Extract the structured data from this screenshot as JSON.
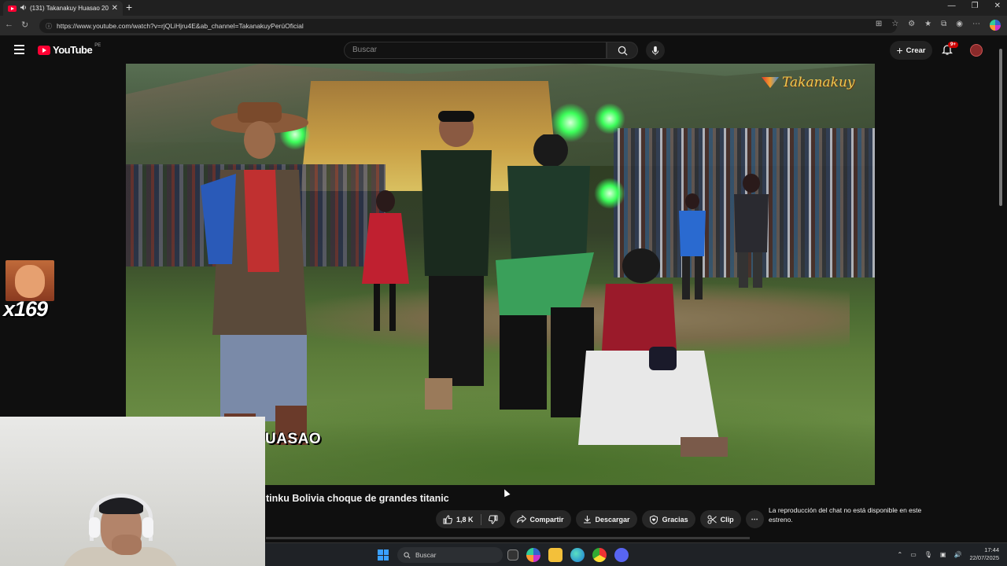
{
  "browser": {
    "tab_title": "(131) Takanakuy Huasao 20…",
    "url": "https://www.youtube.com/watch?v=rjQLiHjru4E&ab_channel=TakanakuyPerúOficial"
  },
  "youtube": {
    "logo_text": "YouTube",
    "country_code": "PE",
    "search_placeholder": "Buscar",
    "create_label": "Crear",
    "notifications_badge": "9+"
  },
  "video": {
    "watermark_text": "Takanakuy",
    "caption_overlay": "UASAO",
    "title": "tinku Bolivia choque de grandes titanic"
  },
  "overlay": {
    "multiplier_text": "x169"
  },
  "actions": {
    "like_count": "1,8 K",
    "share_label": "Compartir",
    "download_label": "Descargar",
    "thanks_label": "Gracias",
    "clip_label": "Clip"
  },
  "chat": {
    "unavailable_text": "La reproducción del chat no está disponible en este estreno."
  },
  "taskbar": {
    "search_placeholder": "Buscar",
    "time": "17:44",
    "date": "22/07/2025"
  },
  "colors": {
    "youtube_red": "#ff0033",
    "background": "#0f0f0f",
    "pill_bg": "#272727"
  }
}
